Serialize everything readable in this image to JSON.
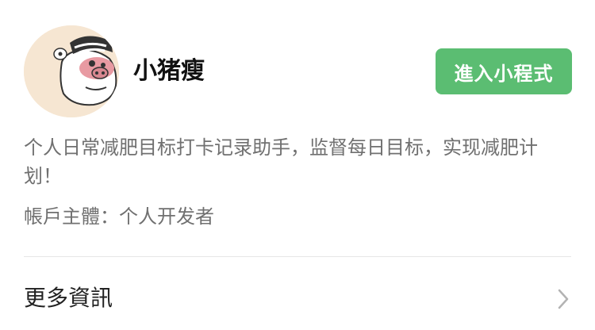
{
  "app": {
    "name": "小猪瘦",
    "avatar_icon": "cartoon-pig-avatar-icon",
    "enter_button_label": "進入小程式",
    "description": "个人日常减肥目标打卡记录助手，监督每日目标，实现减肥计划！",
    "account_subject": "帳戶主體：个人开发者"
  },
  "more_info": {
    "label": "更多資訊",
    "icon": "chevron-right-icon"
  },
  "colors": {
    "accent": "#5bbd72",
    "text_primary": "#111111",
    "text_secondary": "#707070",
    "divider": "#e6e6e6"
  }
}
